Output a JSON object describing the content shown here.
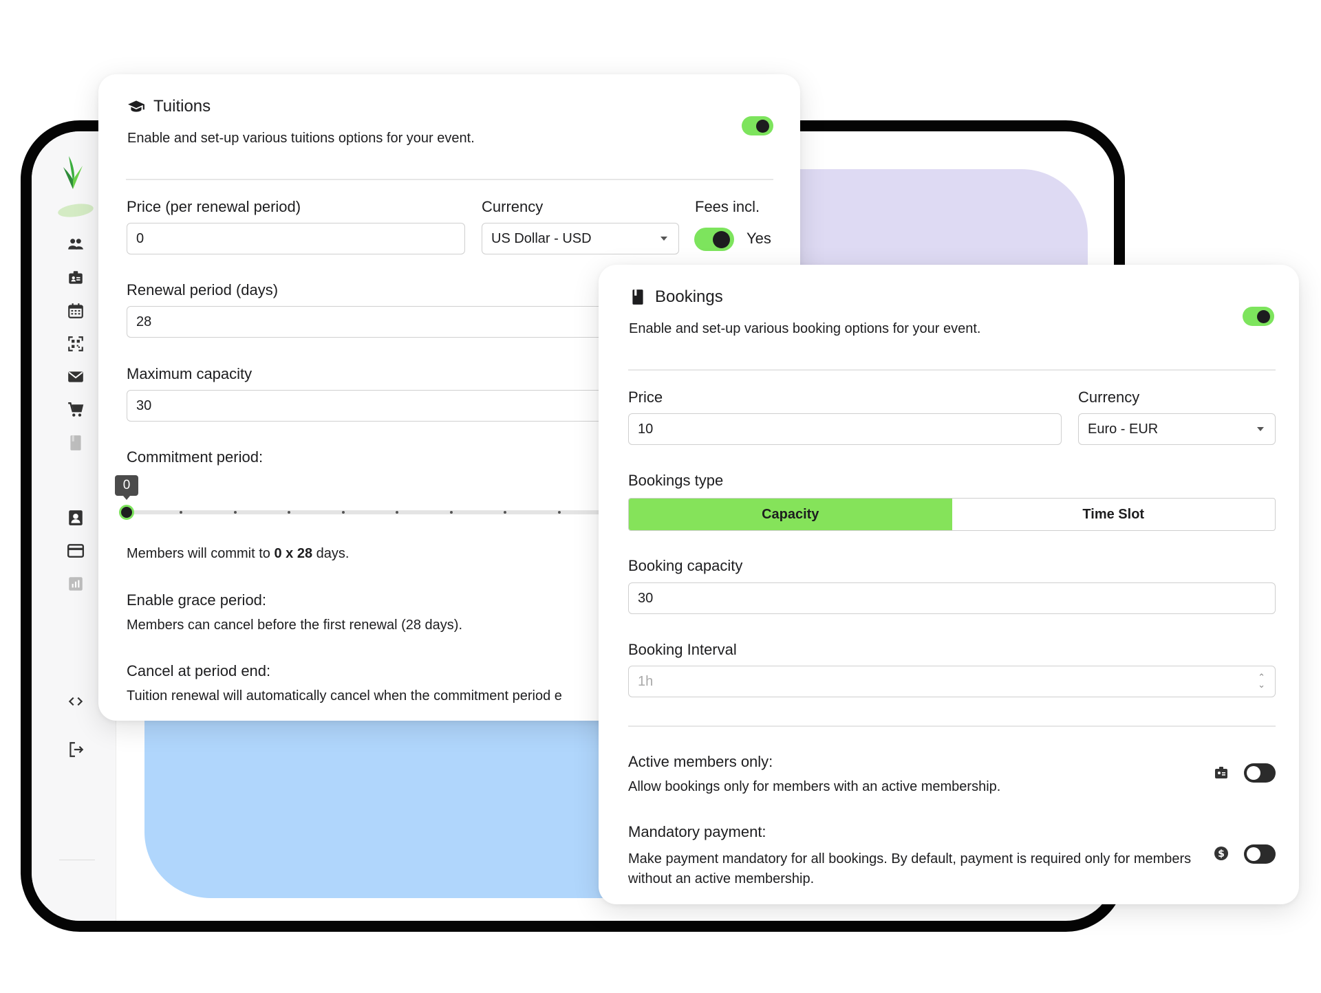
{
  "colors": {
    "accent": "#7de45d",
    "purple_blob": "#dedaf3",
    "blue_blob": "#b0d6fc",
    "frame": "#050505"
  },
  "sidebar": {
    "icons": [
      "members-icon",
      "badge-icon",
      "calendar-icon",
      "qr-code-icon",
      "mail-icon",
      "cart-icon",
      "book-icon",
      "contact-icon",
      "credit-card-icon",
      "report-icon",
      "code-icon",
      "logout-icon"
    ]
  },
  "tuitions": {
    "title": "Tuitions",
    "description": "Enable and set-up various tuitions options for your event.",
    "enabled": true,
    "price_label": "Price (per renewal period)",
    "price_value": "0",
    "currency_label": "Currency",
    "currency_value": "US Dollar - USD",
    "fees_label": "Fees incl.",
    "fees_value": "Yes",
    "renewal_label": "Renewal period (days)",
    "renewal_value": "28",
    "capacity_label": "Maximum capacity",
    "capacity_value": "30",
    "commitment_label": "Commitment period:",
    "commitment_slider_value": "0",
    "commit_text_prefix": "Members will commit to ",
    "commit_text_bold": "0 x 28",
    "commit_text_suffix": " days.",
    "grace_label": "Enable grace period:",
    "grace_text": "Members can cancel before the first renewal (28 days).",
    "cancel_label": "Cancel at period end:",
    "cancel_text": "Tuition renewal will automatically cancel when the commitment period e"
  },
  "bookings": {
    "title": "Bookings",
    "description": "Enable and set-up various booking options for your event.",
    "enabled": true,
    "price_label": "Price",
    "price_value": "10",
    "currency_label": "Currency",
    "currency_value": "Euro - EUR",
    "type_label": "Bookings type",
    "type_options": [
      "Capacity",
      "Time Slot"
    ],
    "type_selected": "Capacity",
    "capacity_label": "Booking capacity",
    "capacity_value": "30",
    "interval_label": "Booking Interval",
    "interval_placeholder": "1h",
    "active_label": "Active members only:",
    "active_text": "Allow bookings only for members with an active membership.",
    "active_enabled": false,
    "payment_label": "Mandatory payment:",
    "payment_text": "Make payment mandatory for all bookings. By default, payment is required only for members without an active membership.",
    "payment_enabled": false
  }
}
